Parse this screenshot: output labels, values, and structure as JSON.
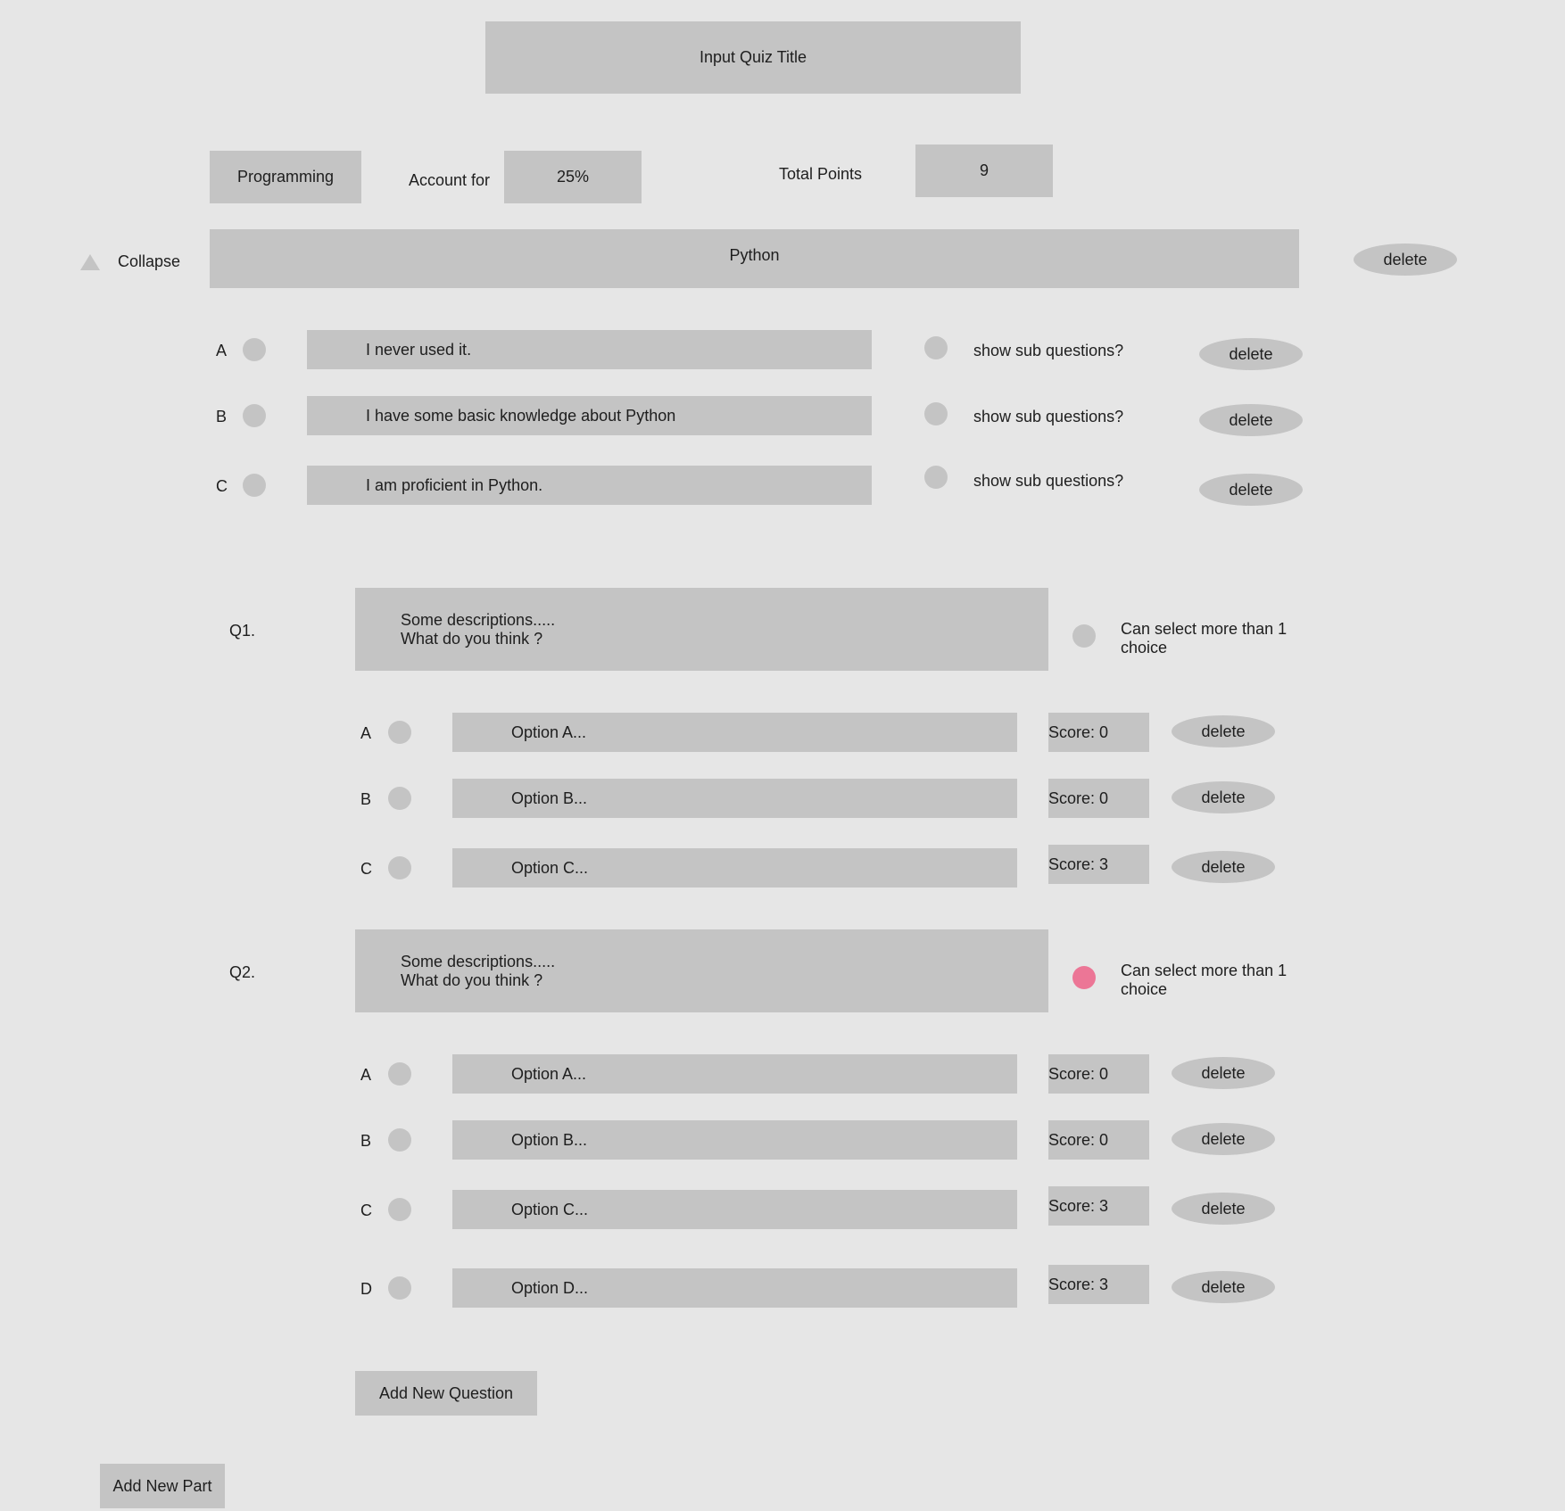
{
  "quiz": {
    "title_placeholder": "Input Quiz Title",
    "category": "Programming",
    "account_for_label": "Account for",
    "account_for_value": "25%",
    "total_points_label": "Total Points",
    "total_points_value": "9"
  },
  "part": {
    "collapse_label": "Collapse",
    "title": "Python",
    "delete_label": "delete",
    "answers": [
      {
        "letter": "A",
        "text": "I never used it.",
        "sub_label": "show sub questions?",
        "delete_label": "delete"
      },
      {
        "letter": "B",
        "text": "I have some basic knowledge about Python",
        "sub_label": "show sub questions?",
        "delete_label": "delete"
      },
      {
        "letter": "C",
        "text": "I am proficient in Python.",
        "sub_label": "show sub questions?",
        "delete_label": "delete"
      }
    ]
  },
  "questions": [
    {
      "number": "Q1.",
      "description_line1": "Some descriptions.....",
      "description_line2": "What do you think ?",
      "multi_select_label_line1": "Can select more than 1",
      "multi_select_label_line2": "choice",
      "multi_select_enabled": false,
      "options": [
        {
          "letter": "A",
          "text": "Option A...",
          "score": "Score: 0",
          "delete_label": "delete"
        },
        {
          "letter": "B",
          "text": "Option B...",
          "score": "Score: 0",
          "delete_label": "delete"
        },
        {
          "letter": "C",
          "text": "Option C...",
          "score": "Score: 3",
          "delete_label": "delete"
        }
      ]
    },
    {
      "number": "Q2.",
      "description_line1": "Some descriptions.....",
      "description_line2": "What do you think ?",
      "multi_select_label_line1": "Can select more than 1",
      "multi_select_label_line2": "choice",
      "multi_select_enabled": true,
      "options": [
        {
          "letter": "A",
          "text": "Option A...",
          "score": "Score: 0",
          "delete_label": "delete"
        },
        {
          "letter": "B",
          "text": "Option B...",
          "score": "Score: 0",
          "delete_label": "delete"
        },
        {
          "letter": "C",
          "text": "Option C...",
          "score": "Score: 3",
          "delete_label": "delete"
        },
        {
          "letter": "D",
          "text": "Option D...",
          "score": "Score: 3",
          "delete_label": "delete"
        }
      ]
    }
  ],
  "actions": {
    "add_question_label": "Add New Question",
    "add_part_label": "Add New Part"
  },
  "colors": {
    "background": "#e6e6e6",
    "field": "#c4c4c4",
    "toggle_on": "#ec7696",
    "text": "#1e1e1e"
  }
}
